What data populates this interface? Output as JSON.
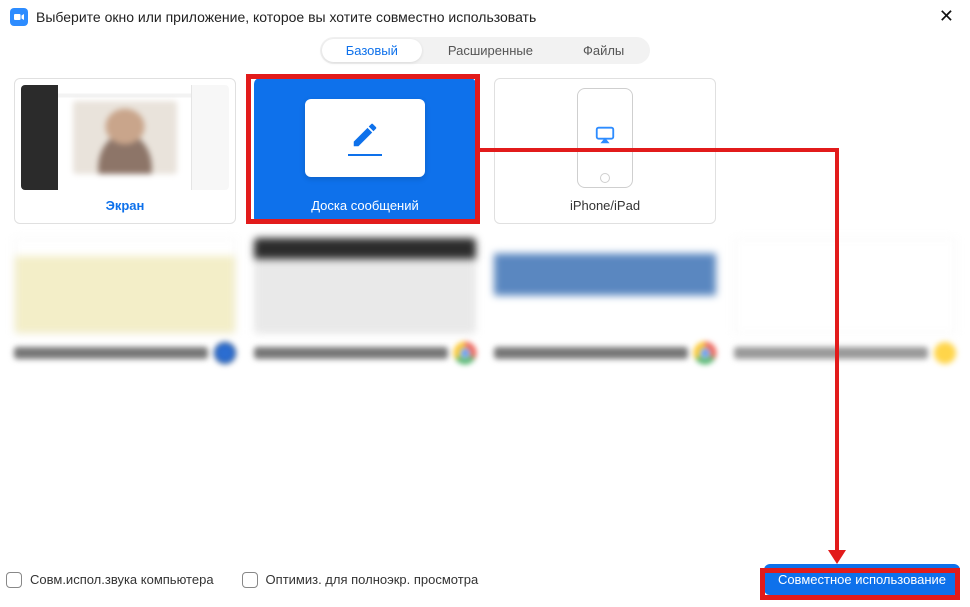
{
  "window": {
    "title": "Выберите окно или приложение, которое вы хотите совместно использовать"
  },
  "tabs": {
    "basic": "Базовый",
    "advanced": "Расширенные",
    "files": "Файлы"
  },
  "options": {
    "screen": "Экран",
    "whiteboard": "Доска сообщений",
    "iphone": "iPhone/iPad"
  },
  "footer": {
    "share_audio": "Совм.испол.звука компьютера",
    "optimize_video": "Оптимиз. для полноэкр. просмотра",
    "share_button": "Совместное использование"
  }
}
